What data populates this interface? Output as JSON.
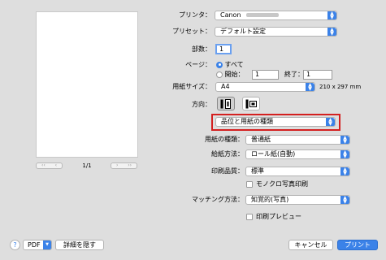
{
  "preview": {
    "page_indicator": "1/1"
  },
  "printer": {
    "label": "プリンタ：",
    "value": "Canon"
  },
  "preset": {
    "label": "プリセット：",
    "value": "デフォルト設定"
  },
  "copies": {
    "label": "部数：",
    "value": "1"
  },
  "pages": {
    "label": "ページ：",
    "all_label": "すべて",
    "from_label": "開始：",
    "from_value": "1",
    "to_label": "終了：",
    "to_value": "1"
  },
  "paper_size": {
    "label": "用紙サイズ：",
    "value": "A4",
    "dimensions": "210 x 297 mm"
  },
  "orientation": {
    "label": "方向："
  },
  "section_menu": {
    "value": "品位と用紙の種類"
  },
  "media_type": {
    "label": "用紙の種類：",
    "value": "普通紙"
  },
  "paper_source": {
    "label": "給紙方法：",
    "value": "ロール紙(自動)"
  },
  "print_quality": {
    "label": "印刷品質：",
    "value": "標準"
  },
  "grayscale": {
    "label": "モノクロ写真印刷"
  },
  "matching": {
    "label": "マッチング方法：",
    "value": "知覚的(写真)"
  },
  "print_preview": {
    "label": "印刷プレビュー"
  },
  "footer": {
    "help": "?",
    "pdf_label": "PDF",
    "hide_details": "詳細を隠す",
    "cancel": "キャンセル",
    "print": "プリント"
  },
  "colors": {
    "accent": "#3b82e8",
    "highlight_border": "#d42020"
  }
}
